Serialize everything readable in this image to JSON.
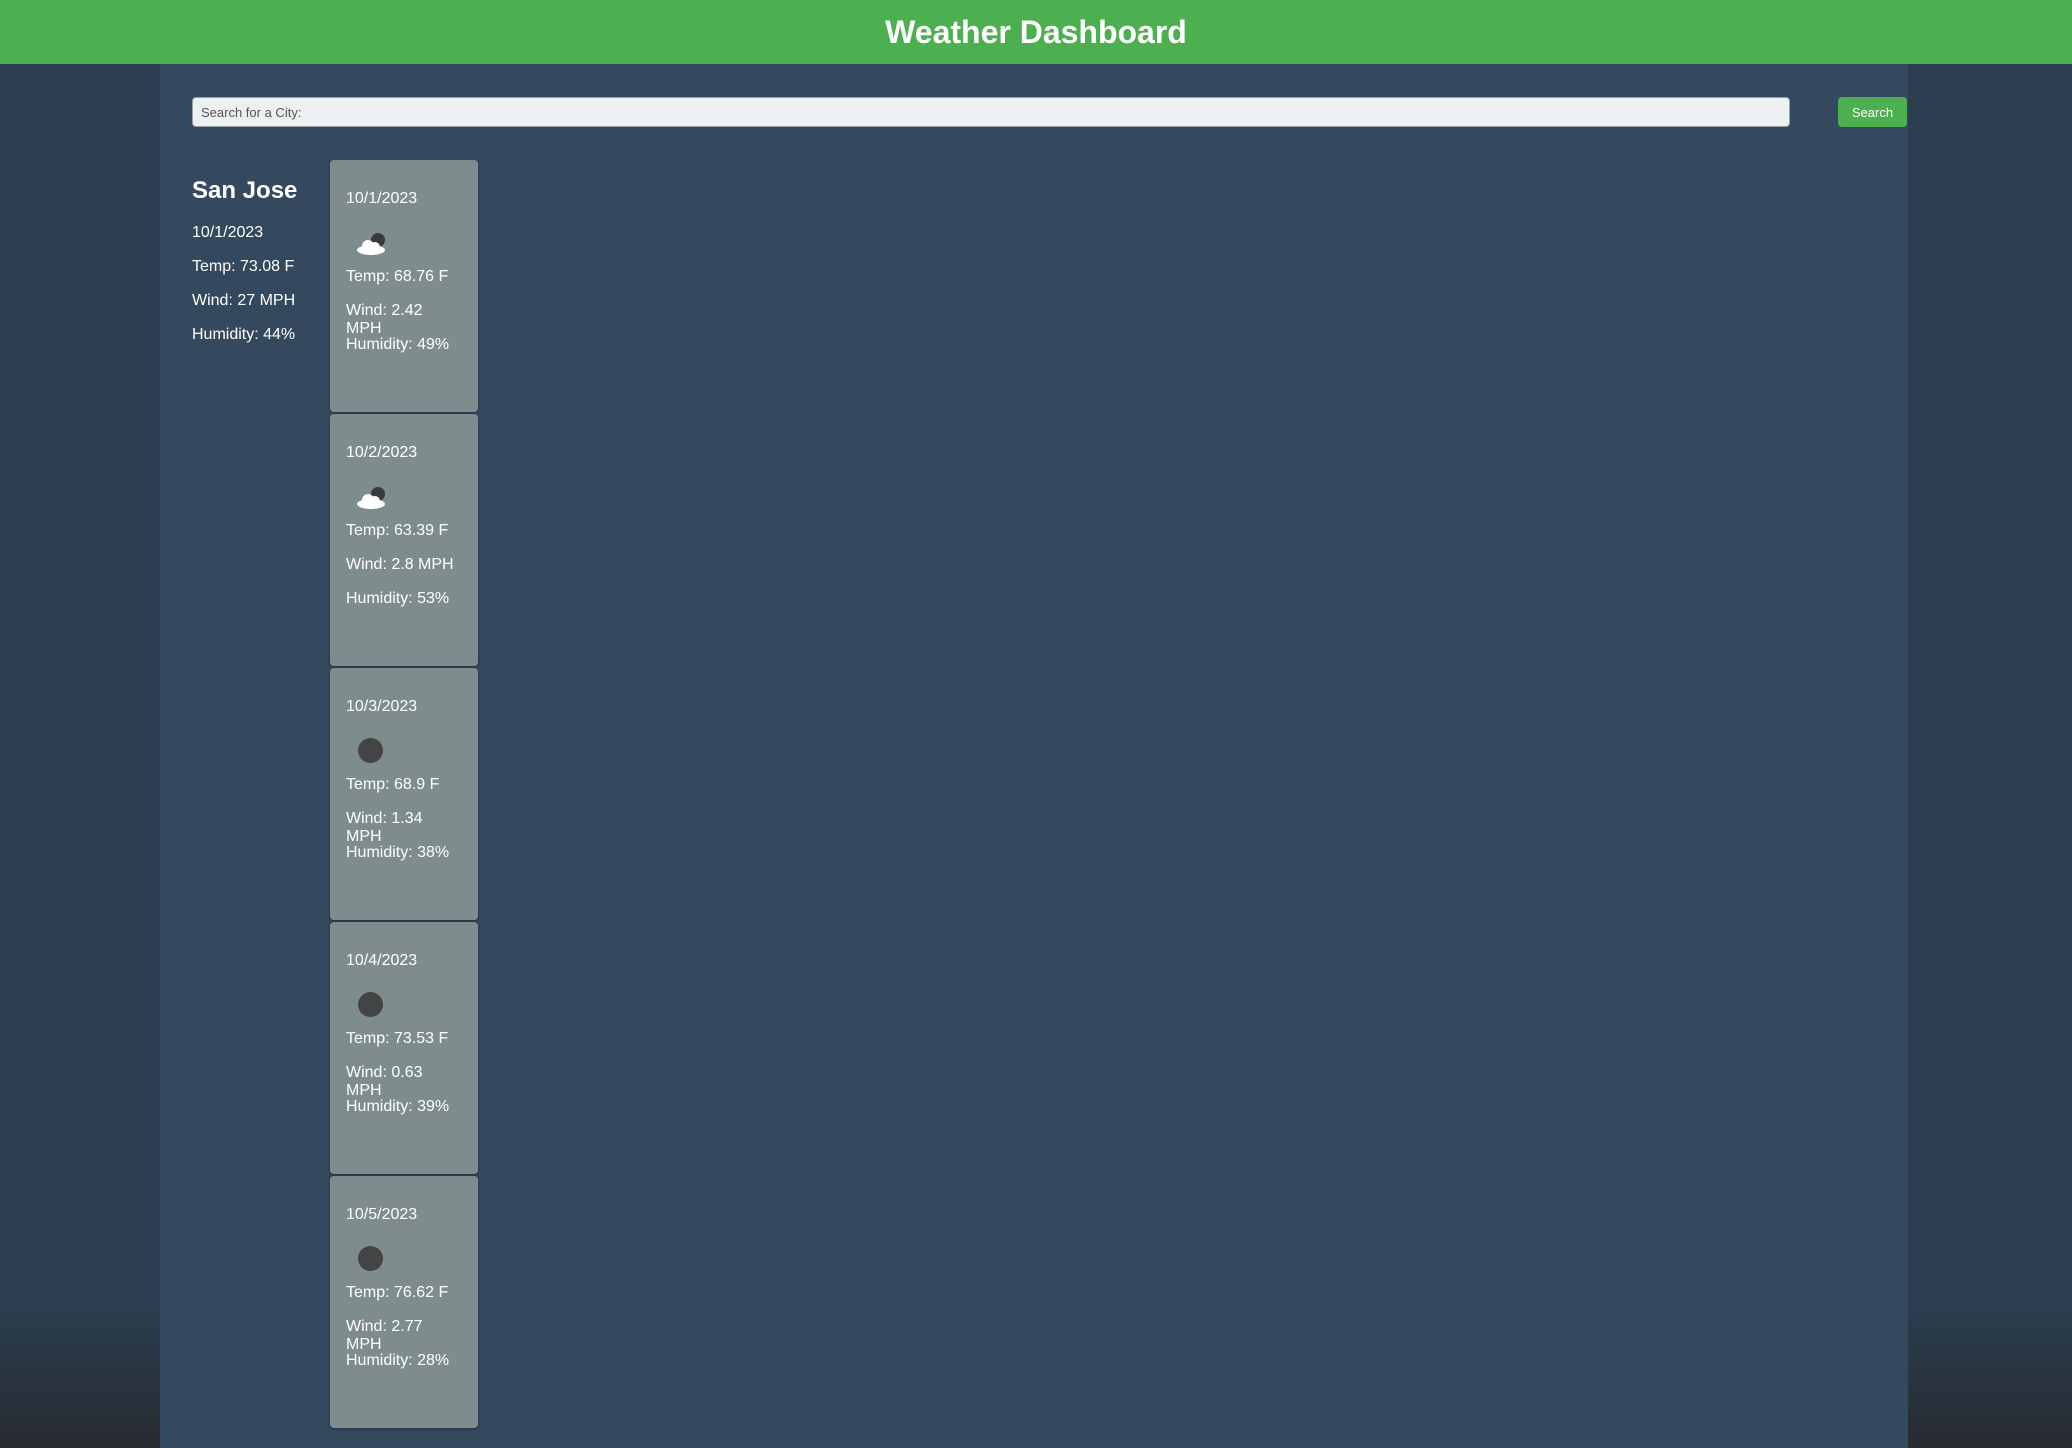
{
  "header": {
    "title": "Weather Dashboard"
  },
  "search": {
    "placeholder": "Search for a City:",
    "button_label": "Search"
  },
  "current": {
    "city": "San Jose",
    "date": "10/1/2023",
    "temp": "Temp: 73.08 F",
    "wind": "Wind: 27 MPH",
    "humidity": "Humidity: 44%"
  },
  "forecast": [
    {
      "date": "10/1/2023",
      "icon": "partly-cloudy-night-icon",
      "temp": "Temp: 68.76 F",
      "wind": "Wind: 2.42 MPH",
      "humidity": "Humidity: 49%"
    },
    {
      "date": "10/2/2023",
      "icon": "partly-cloudy-night-icon",
      "temp": "Temp: 63.39 F",
      "wind": "Wind: 2.8 MPH",
      "humidity": "Humidity: 53%"
    },
    {
      "date": "10/3/2023",
      "icon": "clear-night-icon",
      "temp": "Temp: 68.9 F",
      "wind": "Wind: 1.34 MPH",
      "humidity": "Humidity: 38%"
    },
    {
      "date": "10/4/2023",
      "icon": "clear-night-icon",
      "temp": "Temp: 73.53 F",
      "wind": "Wind: 0.63 MPH",
      "humidity": "Humidity: 39%"
    },
    {
      "date": "10/5/2023",
      "icon": "clear-night-icon",
      "temp": "Temp: 76.62 F",
      "wind": "Wind: 2.77 MPH",
      "humidity": "Humidity: 28%"
    }
  ],
  "colors": {
    "accent": "#4caf50",
    "panel": "#34495e",
    "background": "#2c3e50",
    "card": "#7f8c8d"
  }
}
